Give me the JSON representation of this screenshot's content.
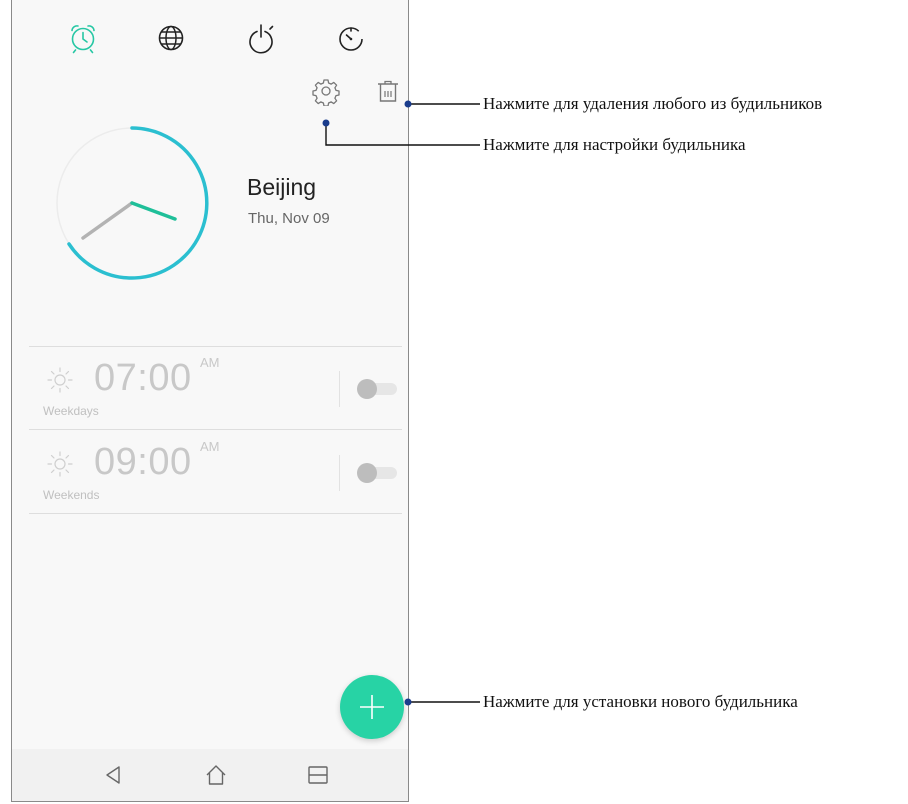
{
  "tabs": [
    {
      "name": "alarm-tab",
      "icon": "alarm-clock-icon",
      "active": true
    },
    {
      "name": "world-clock-tab",
      "icon": "globe-icon",
      "active": false
    },
    {
      "name": "stopwatch-tab",
      "icon": "stopwatch-icon",
      "active": false
    },
    {
      "name": "timer-tab",
      "icon": "timer-icon",
      "active": false
    }
  ],
  "toolbar": {
    "settings_icon": "gear-icon",
    "delete_icon": "trash-icon"
  },
  "clock": {
    "city": "Beijing",
    "date": "Thu, Nov 09"
  },
  "alarms": [
    {
      "time": "07:00",
      "ampm": "AM",
      "repeat": "Weekdays",
      "enabled": false,
      "icon": "sun-icon"
    },
    {
      "time": "09:00",
      "ampm": "AM",
      "repeat": "Weekends",
      "enabled": false,
      "icon": "sun-icon"
    }
  ],
  "fab": {
    "icon": "plus-icon"
  },
  "navbar": {
    "back_icon": "back-triangle-icon",
    "home_icon": "home-icon",
    "recents_icon": "recents-icon"
  },
  "callouts": {
    "delete": "Нажмите для удаления любого из будильников",
    "settings": "Нажмите для настройки будильника",
    "add": "Нажмите для установки нового будильника"
  },
  "colors": {
    "accent": "#27d3a5",
    "clock_arc": "#2bbfd0",
    "active_tab": "#26c7a4"
  }
}
